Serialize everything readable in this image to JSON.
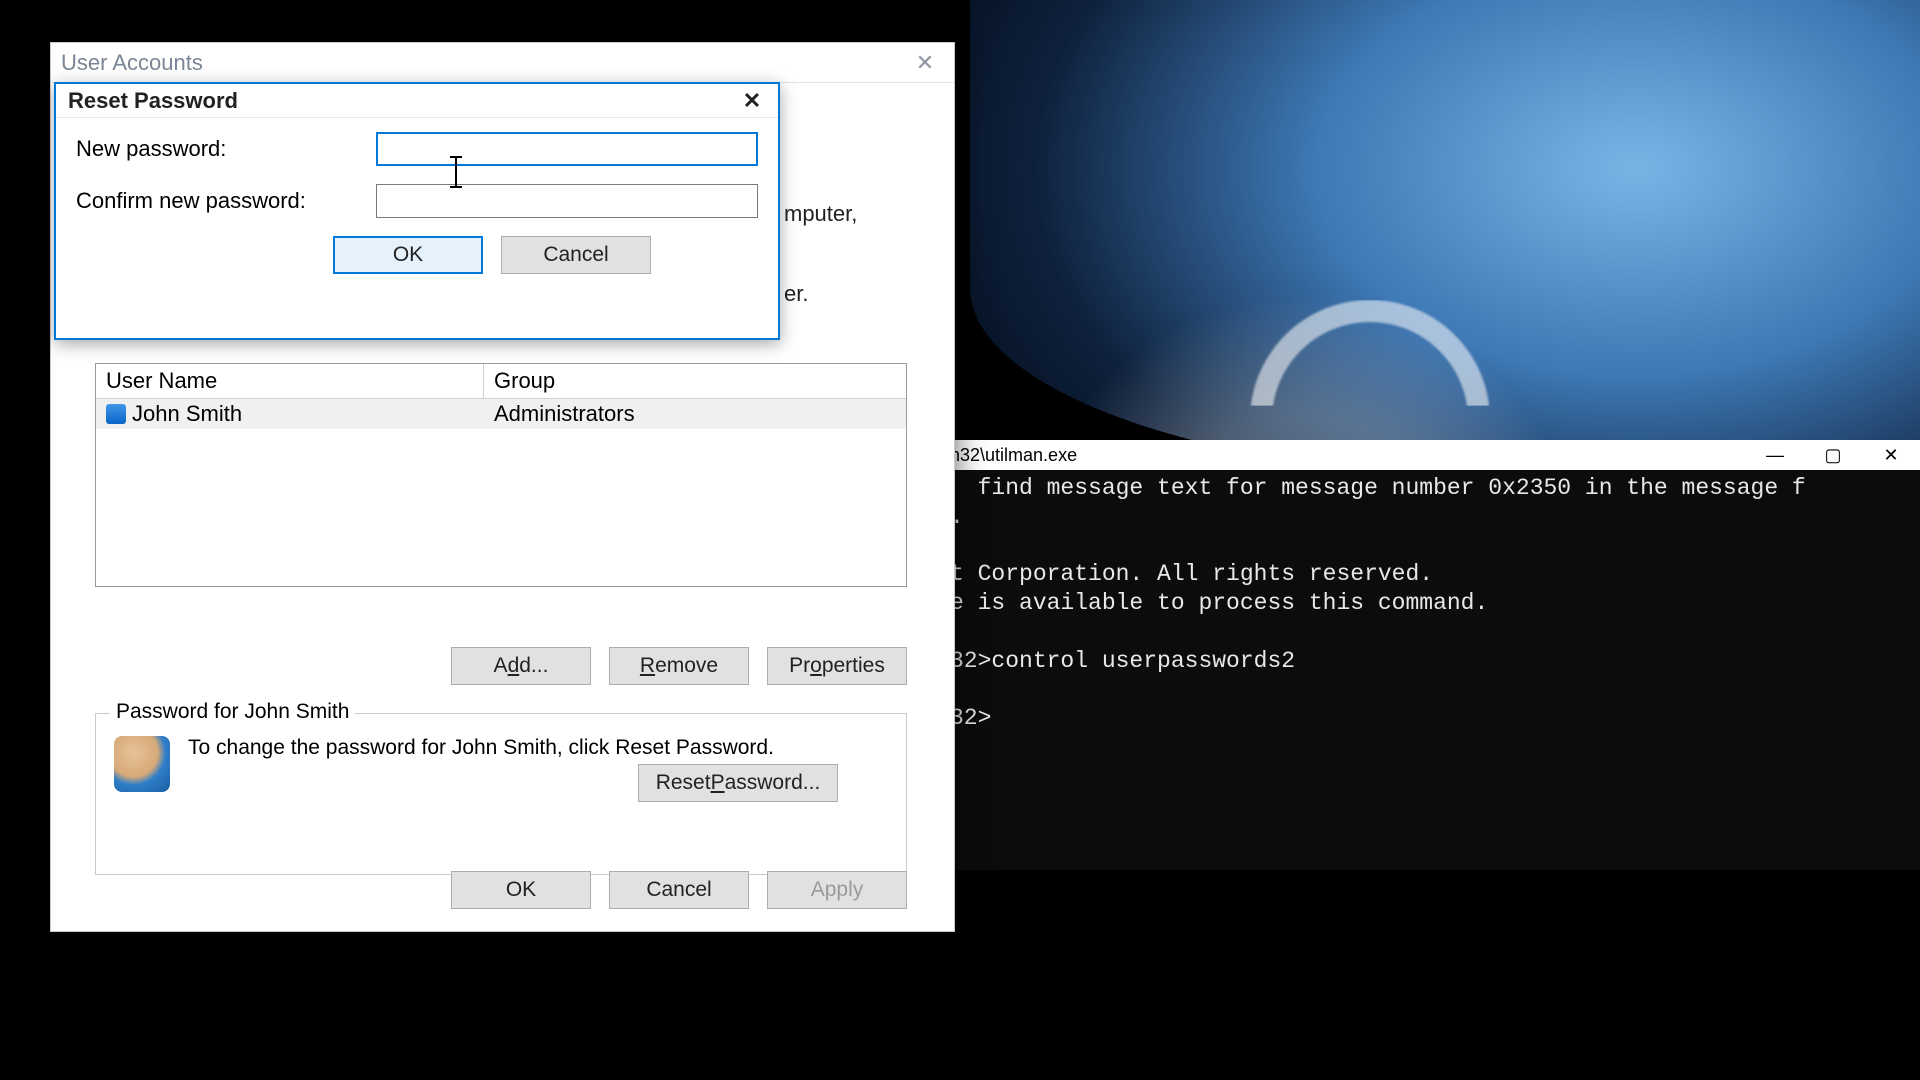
{
  "desktop": {
    "cortana_ring": true
  },
  "cmd": {
    "title": "n32\\utilman.exe",
    "lines": [
      "  find message text for message number 0x2350 in the message f",
      ".",
      "",
      "t Corporation. All rights reserved.",
      "e is available to process this command.",
      "",
      "32>control userpasswords2",
      "",
      "32>"
    ]
  },
  "user_accounts": {
    "title": "User Accounts",
    "hint_fragments": {
      "l1": "mputer,",
      "l2": "er."
    },
    "list": {
      "columns": {
        "user": "User Name",
        "group": "Group"
      },
      "rows": [
        {
          "user": "John Smith",
          "group": "Administrators"
        }
      ]
    },
    "buttons": {
      "add": {
        "pre": "A",
        "u": "d",
        "post": "d..."
      },
      "remove": {
        "pre": "",
        "u": "R",
        "post": "emove"
      },
      "properties": {
        "pre": "Pr",
        "u": "o",
        "post": "perties"
      }
    },
    "password_group": {
      "legend": "Password for John Smith",
      "message": "To change the password for John Smith, click Reset Password.",
      "reset_button": {
        "pre": "Reset ",
        "u": "P",
        "post": "assword..."
      }
    },
    "bottom": {
      "ok": "OK",
      "cancel": "Cancel",
      "apply": "Apply"
    }
  },
  "reset_password": {
    "title": "Reset Password",
    "label_new": "New password:",
    "label_confirm": "Confirm new password:",
    "value_new": "",
    "value_confirm": "",
    "ok": "OK",
    "cancel": "Cancel"
  }
}
